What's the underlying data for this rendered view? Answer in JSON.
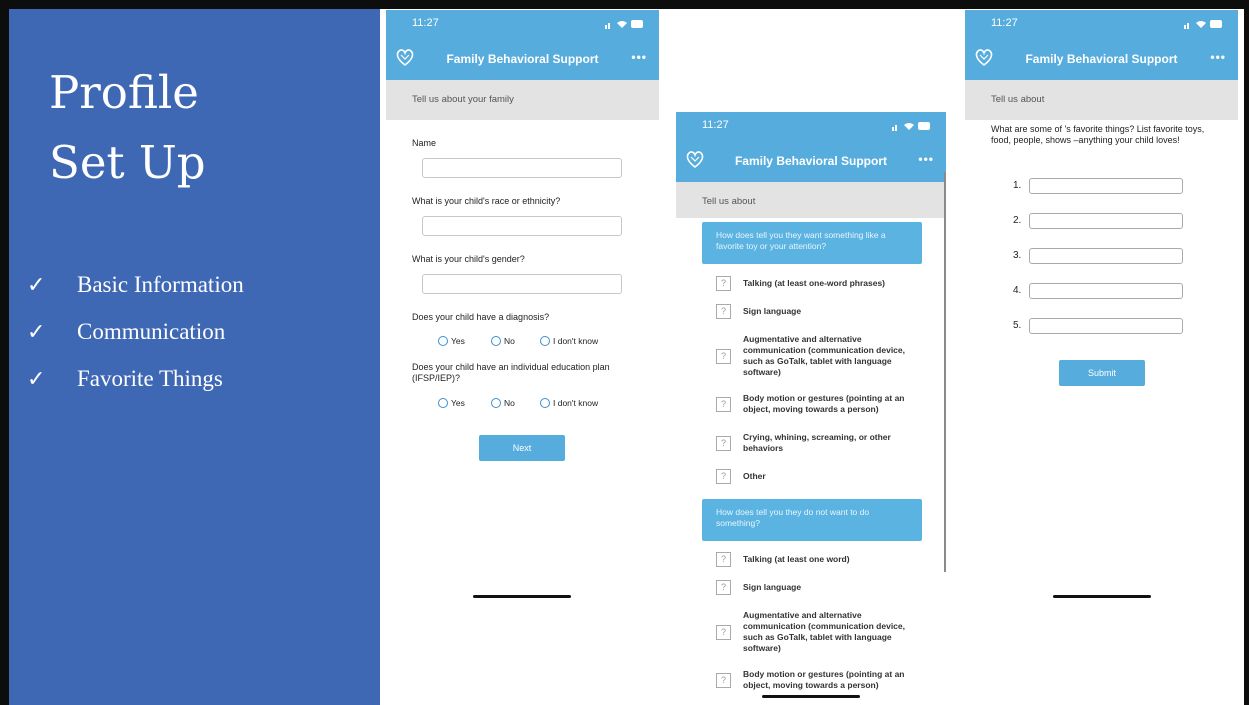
{
  "slide": {
    "title_line1": "Profile",
    "title_line2": "Set Up",
    "checklist": [
      {
        "check": "✓",
        "label": "Basic Information"
      },
      {
        "check": "✓",
        "label": "Communication"
      },
      {
        "check": "✓",
        "label": "Favorite Things"
      }
    ]
  },
  "app": {
    "status_time": "11:27",
    "title": "Family Behavioral Support",
    "menu": "•••",
    "colors": {
      "accent": "#56acdd",
      "sidebar": "#3f68b4",
      "subheader": "#e3e3e3"
    }
  },
  "screen1": {
    "header": "Tell us about your family",
    "name_label": "Name",
    "race_label": "What is your child's race or ethnicity?",
    "gender_label": "What is your child's gender?",
    "diagnosis_label": "Does your child have a diagnosis?",
    "iep_label": "Does your child have an individual education plan (IFSP/IEP)?",
    "options": [
      "Yes",
      "No",
      "I don't know"
    ],
    "next": "Next"
  },
  "screen2": {
    "header": "Tell us about",
    "q1": "How does  tell you they want something like a favorite toy or your attention?",
    "q1_options": [
      "Talking (at least one-word phrases)",
      "Sign language",
      "Augmentative and alternative communication (communication device, such as GoTalk, tablet with language software)",
      "Body motion or gestures (pointing at an object, moving towards a person)",
      "Crying, whining, screaming, or other behaviors",
      "Other"
    ],
    "q2": "How does  tell you they do not want to do something?",
    "q2_options": [
      "Talking (at least one word)",
      "Sign language",
      "Augmentative and alternative communication (communication device, such as GoTalk, tablet with language software)",
      "Body motion or gestures (pointing at an object, moving towards a person)"
    ],
    "checkbox_glyph": "?"
  },
  "screen3": {
    "header": "Tell us about",
    "question": "What are some of 's favorite things? List favorite toys, food, people, shows –anything your child loves!",
    "numbers": [
      "1.",
      "2.",
      "3.",
      "4.",
      "5."
    ],
    "submit": "Submit"
  }
}
